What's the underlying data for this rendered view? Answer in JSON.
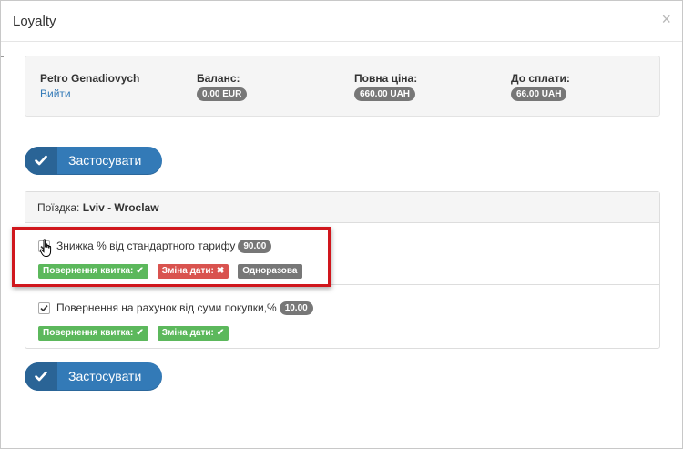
{
  "modal": {
    "title": "Loyalty",
    "close_symbol": "×"
  },
  "user": {
    "name": "Petro Genadiovych",
    "logout_label": "Вийти"
  },
  "summary": {
    "balance_label": "Баланс:",
    "balance_value": "0.00 EUR",
    "full_price_label": "Повна ціна:",
    "full_price_value": "660.00 UAH",
    "to_pay_label": "До сплати:",
    "to_pay_value": "66.00 UAH"
  },
  "apply_label": "Застосувати",
  "trip": {
    "prefix": "Поїздка:",
    "route": "Lviv - Wroclaw"
  },
  "discounts": [
    {
      "label": "Знижка % від стандартного тарифу",
      "value": "90.00",
      "checked": true,
      "tags": [
        {
          "text": "Повернення квитка:",
          "mark": "✔",
          "status": "allowed"
        },
        {
          "text": "Зміна дати:",
          "mark": "✖",
          "status": "denied"
        },
        {
          "text": "Одноразова",
          "mark": "",
          "status": "info"
        }
      ]
    },
    {
      "label": "Повернення на рахунок від суми покупки,%",
      "value": "10.00",
      "checked": true,
      "tags": [
        {
          "text": "Повернення квитка:",
          "mark": "✔",
          "status": "allowed"
        },
        {
          "text": "Зміна дати:",
          "mark": "✔",
          "status": "allowed"
        }
      ]
    }
  ],
  "colors": {
    "primary": "#337ab7",
    "success": "#5cb85c",
    "danger": "#d9534f",
    "badge": "#777777",
    "highlight": "#d0171d"
  },
  "icons": {
    "apply": "check-icon",
    "checkbox": "checkmark-icon",
    "cursor": "hand-pointer-icon"
  }
}
